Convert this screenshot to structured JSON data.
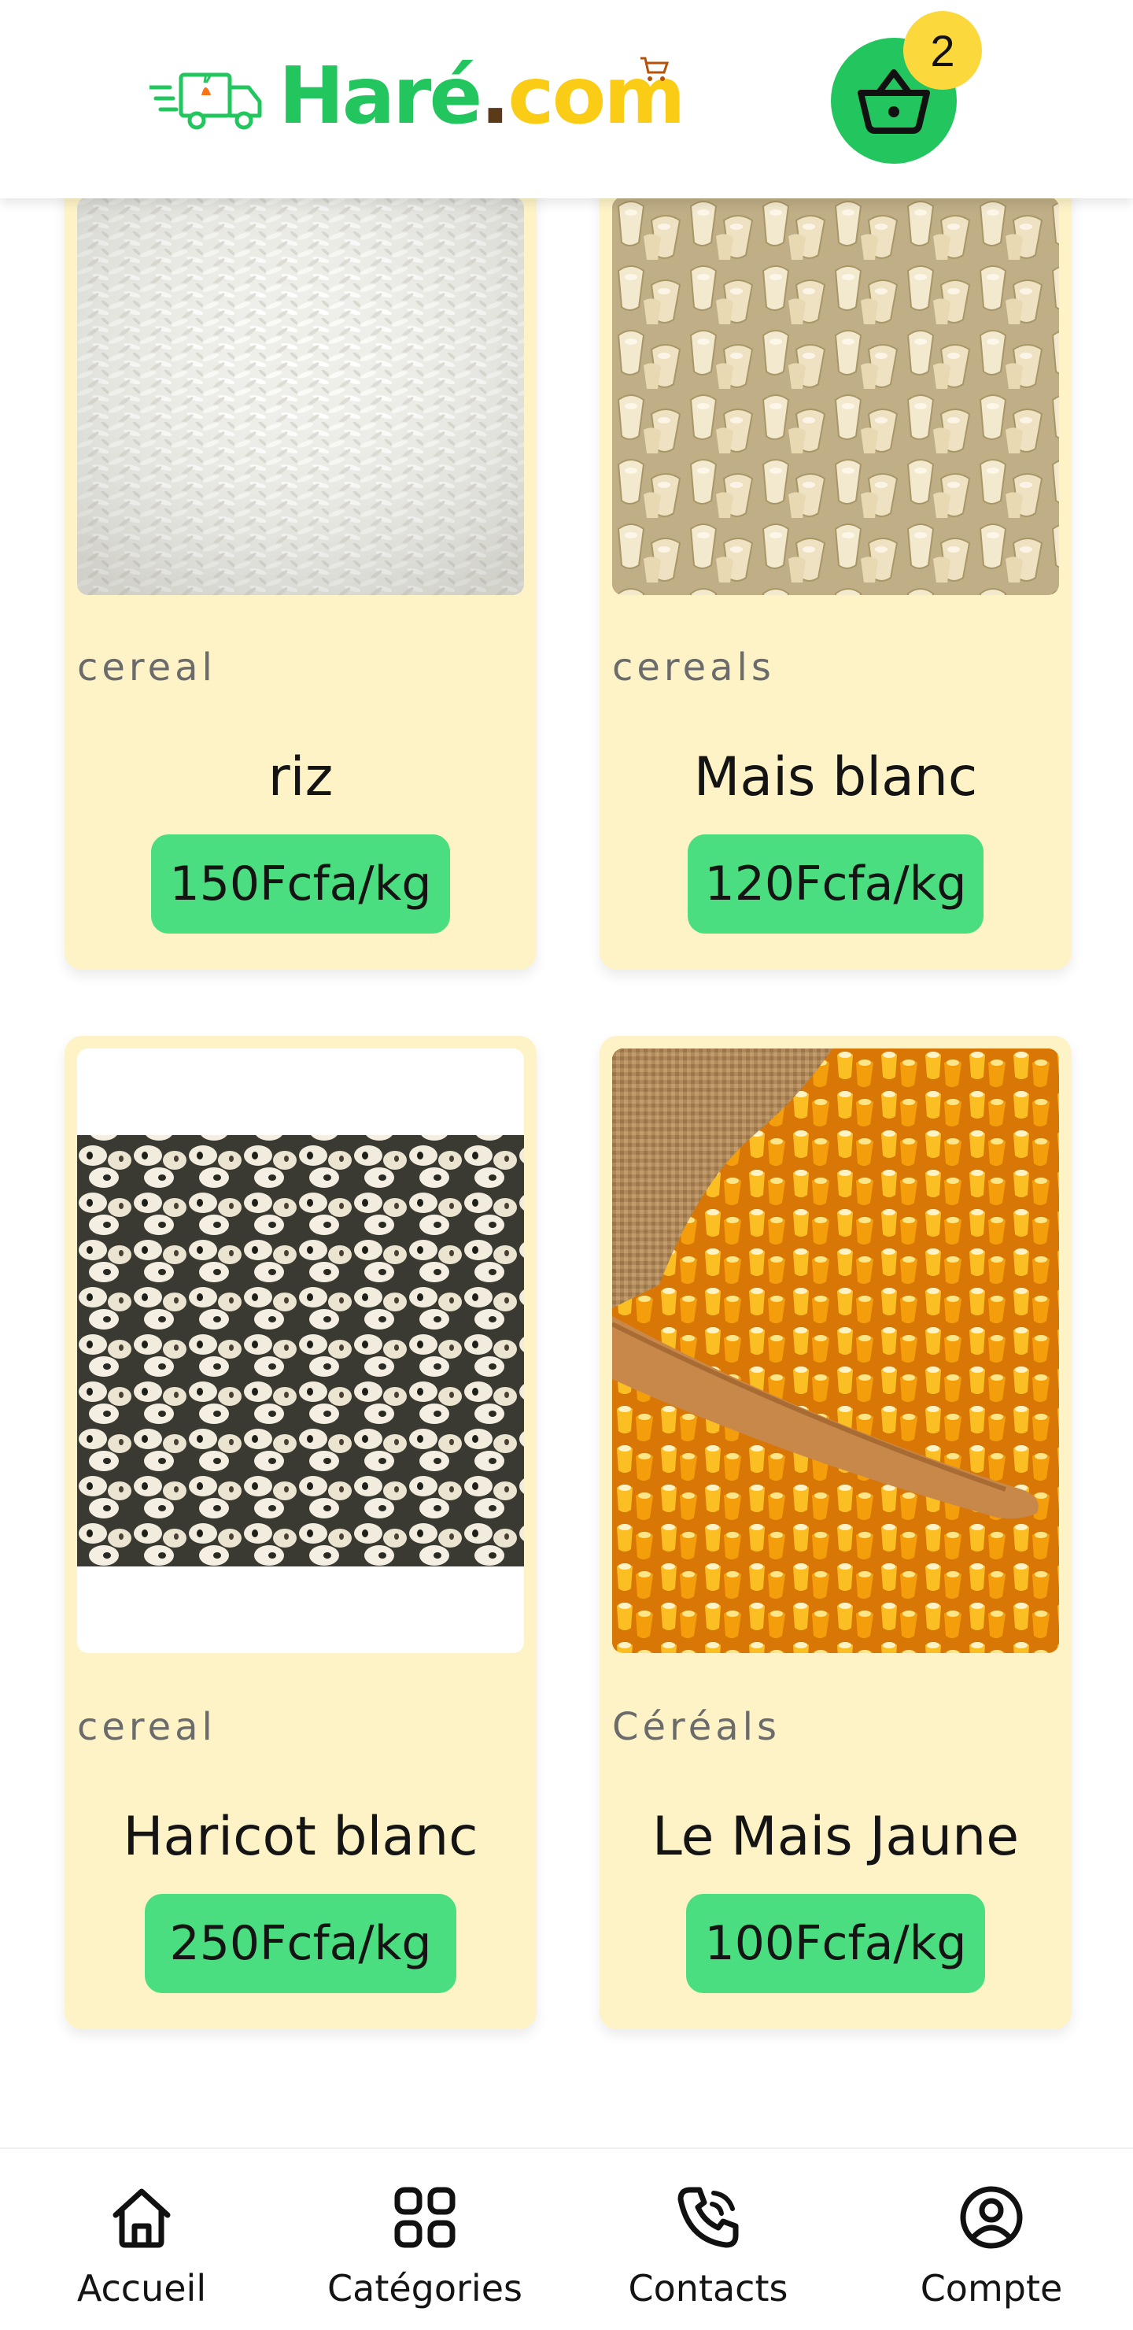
{
  "header": {
    "logo": {
      "part1": "Haré",
      "part2": ".",
      "part3": "com"
    },
    "cart_count": "2",
    "colors": {
      "brand_green": "#22c55e",
      "brand_yellow": "#facc15",
      "badge_yellow": "#fbd83c"
    }
  },
  "products": [
    {
      "category": "cereal",
      "name": "riz",
      "price": "150Fcfa/kg",
      "image": "white-rice-photo"
    },
    {
      "category": "cereals",
      "name": "Mais blanc",
      "price": "120Fcfa/kg",
      "image": "white-corn-kernels-photo"
    },
    {
      "category": "cereal",
      "name": "Haricot blanc",
      "price": "250Fcfa/kg",
      "image": "black-eyed-beans-photo"
    },
    {
      "category": "Céréals",
      "name": "Le Mais Jaune",
      "price": "100Fcfa/kg",
      "image": "yellow-corn-kernels-photo"
    }
  ],
  "card_color": "#fef3c7",
  "price_color": "#4ade80",
  "nav": [
    {
      "label": "Accueil",
      "icon": "home-icon"
    },
    {
      "label": "Catégories",
      "icon": "grid-icon"
    },
    {
      "label": "Contacts",
      "icon": "phone-icon"
    },
    {
      "label": "Compte",
      "icon": "user-circle-icon"
    }
  ]
}
